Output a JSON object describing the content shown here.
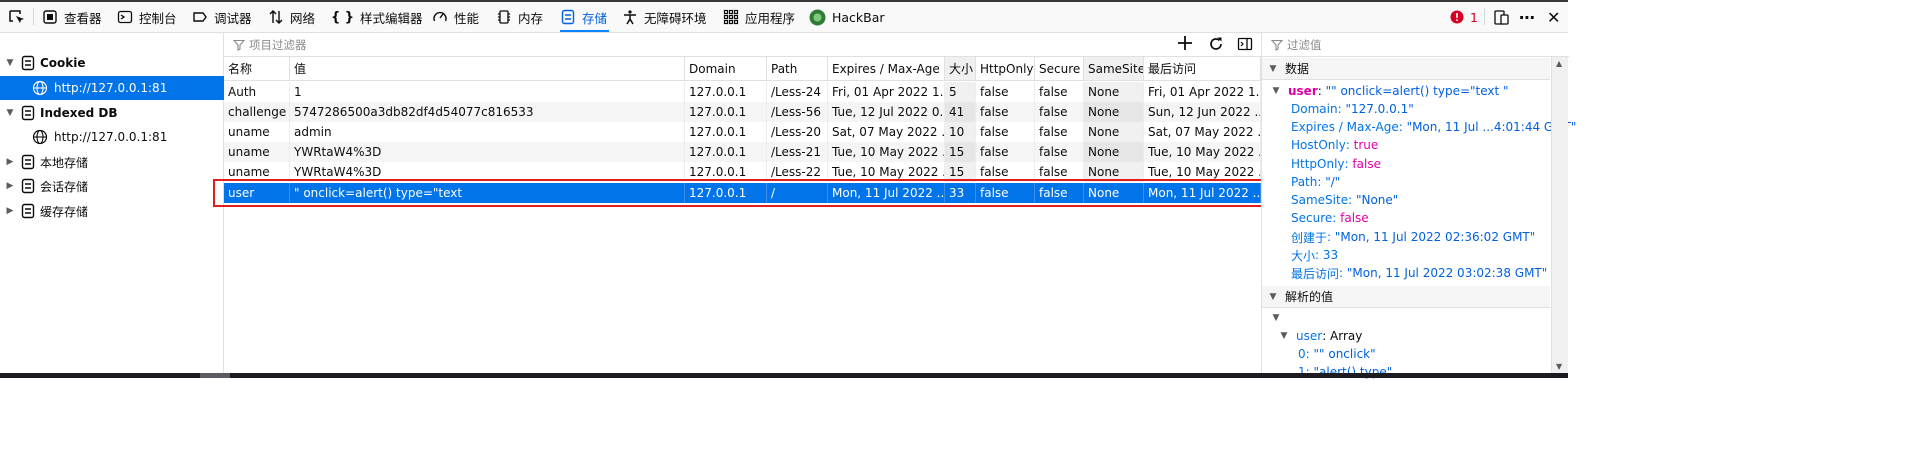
{
  "toolbar": {
    "tabs": [
      {
        "label": "查看器"
      },
      {
        "label": "控制台"
      },
      {
        "label": "调试器"
      },
      {
        "label": "网络"
      },
      {
        "label": "样式编辑器"
      },
      {
        "label": "性能"
      },
      {
        "label": "内存"
      },
      {
        "label": "存储"
      },
      {
        "label": "无障碍环境"
      },
      {
        "label": "应用程序"
      },
      {
        "label": "HackBar"
      }
    ],
    "active_tab": "存储",
    "error_count": "1",
    "accent_color": "#0a84ff",
    "error_color": "#d70022"
  },
  "tree": {
    "items": [
      {
        "label": "Cookie",
        "icon": "storage-icon",
        "expanded": true
      },
      {
        "label": "http://127.0.0.1:81",
        "icon": "globe-icon",
        "selected": true
      },
      {
        "label": "Indexed DB",
        "icon": "storage-icon",
        "expanded": true
      },
      {
        "label": "http://127.0.0.1:81",
        "icon": "globe-icon"
      },
      {
        "label": "本地存储",
        "icon": "storage-icon",
        "expanded": false
      },
      {
        "label": "会话存储",
        "icon": "storage-icon",
        "expanded": false
      },
      {
        "label": "缓存存储",
        "icon": "storage-icon",
        "expanded": false
      }
    ]
  },
  "table": {
    "filter_placeholder": "项目过滤器",
    "columns": [
      "名称",
      "值",
      "Domain",
      "Path",
      "Expires / Max-Age",
      "大小",
      "HttpOnly",
      "Secure",
      "SameSite",
      "最后访问"
    ],
    "rows": [
      [
        "Auth",
        "1",
        "127.0.0.1",
        "/Less-24",
        "Fri, 01 Apr 2022 1...",
        "5",
        "false",
        "false",
        "None",
        "Fri, 01 Apr 2022 1..."
      ],
      [
        "challenge",
        "5747286500a3db82df4d54077c816533",
        "127.0.0.1",
        "/Less-56",
        "Tue, 12 Jul 2022 0...",
        "41",
        "false",
        "false",
        "None",
        "Sun, 12 Jun 2022 ..."
      ],
      [
        "uname",
        "admin",
        "127.0.0.1",
        "/Less-20",
        "Sat, 07 May 2022 ...",
        "10",
        "false",
        "false",
        "None",
        "Sat, 07 May 2022 ..."
      ],
      [
        "uname",
        "YWRtaW4%3D",
        "127.0.0.1",
        "/Less-21",
        "Tue, 10 May 2022 ...",
        "15",
        "false",
        "false",
        "None",
        "Tue, 10 May 2022 ..."
      ],
      [
        "uname",
        "YWRtaW4%3D",
        "127.0.0.1",
        "/Less-22",
        "Tue, 10 May 2022 ...",
        "15",
        "false",
        "false",
        "None",
        "Tue, 10 May 2022 ..."
      ],
      [
        "user",
        "\" onclick=alert() type=\"text",
        "127.0.0.1",
        "/",
        "Mon, 11 Jul 2022 ...",
        "33",
        "false",
        "false",
        "None",
        "Mon, 11 Jul 2022 ..."
      ]
    ],
    "selected_row": 5,
    "highlight_color": "#e01e1e"
  },
  "sidebar": {
    "filter_placeholder": "过滤值",
    "data_section": "数据",
    "parsed_section": "解析的值",
    "record_key": "user",
    "record_value": "\"\" onclick=alert() type=\"text \"",
    "props": [
      {
        "key": "Domain",
        "value": "\"127.0.0.1\"",
        "kind": "string"
      },
      {
        "key": "Expires / Max-Age",
        "value": "\"Mon, 11 Jul ...4:01:44 GMT\"",
        "kind": "string"
      },
      {
        "key": "HostOnly",
        "value": "true",
        "kind": "bool"
      },
      {
        "key": "HttpOnly",
        "value": "false",
        "kind": "bool"
      },
      {
        "key": "Path",
        "value": "\"/\"",
        "kind": "string"
      },
      {
        "key": "SameSite",
        "value": "\"None\"",
        "kind": "string"
      },
      {
        "key": "Secure",
        "value": "false",
        "kind": "bool"
      },
      {
        "key": "创建于",
        "value": "\"Mon, 11 Jul 2022 02:36:02 GMT\"",
        "kind": "string"
      },
      {
        "key": "大小",
        "value": "33",
        "kind": "number"
      },
      {
        "key": "最后访问",
        "value": "\"Mon, 11 Jul 2022 03:02:38 GMT\"",
        "kind": "string"
      }
    ],
    "parsed": {
      "array_key": "user",
      "array_type": "Array",
      "items": [
        {
          "index": "0",
          "value": "\"\" onclick\""
        },
        {
          "index": "1",
          "value": "\"alert() type\""
        }
      ]
    }
  }
}
